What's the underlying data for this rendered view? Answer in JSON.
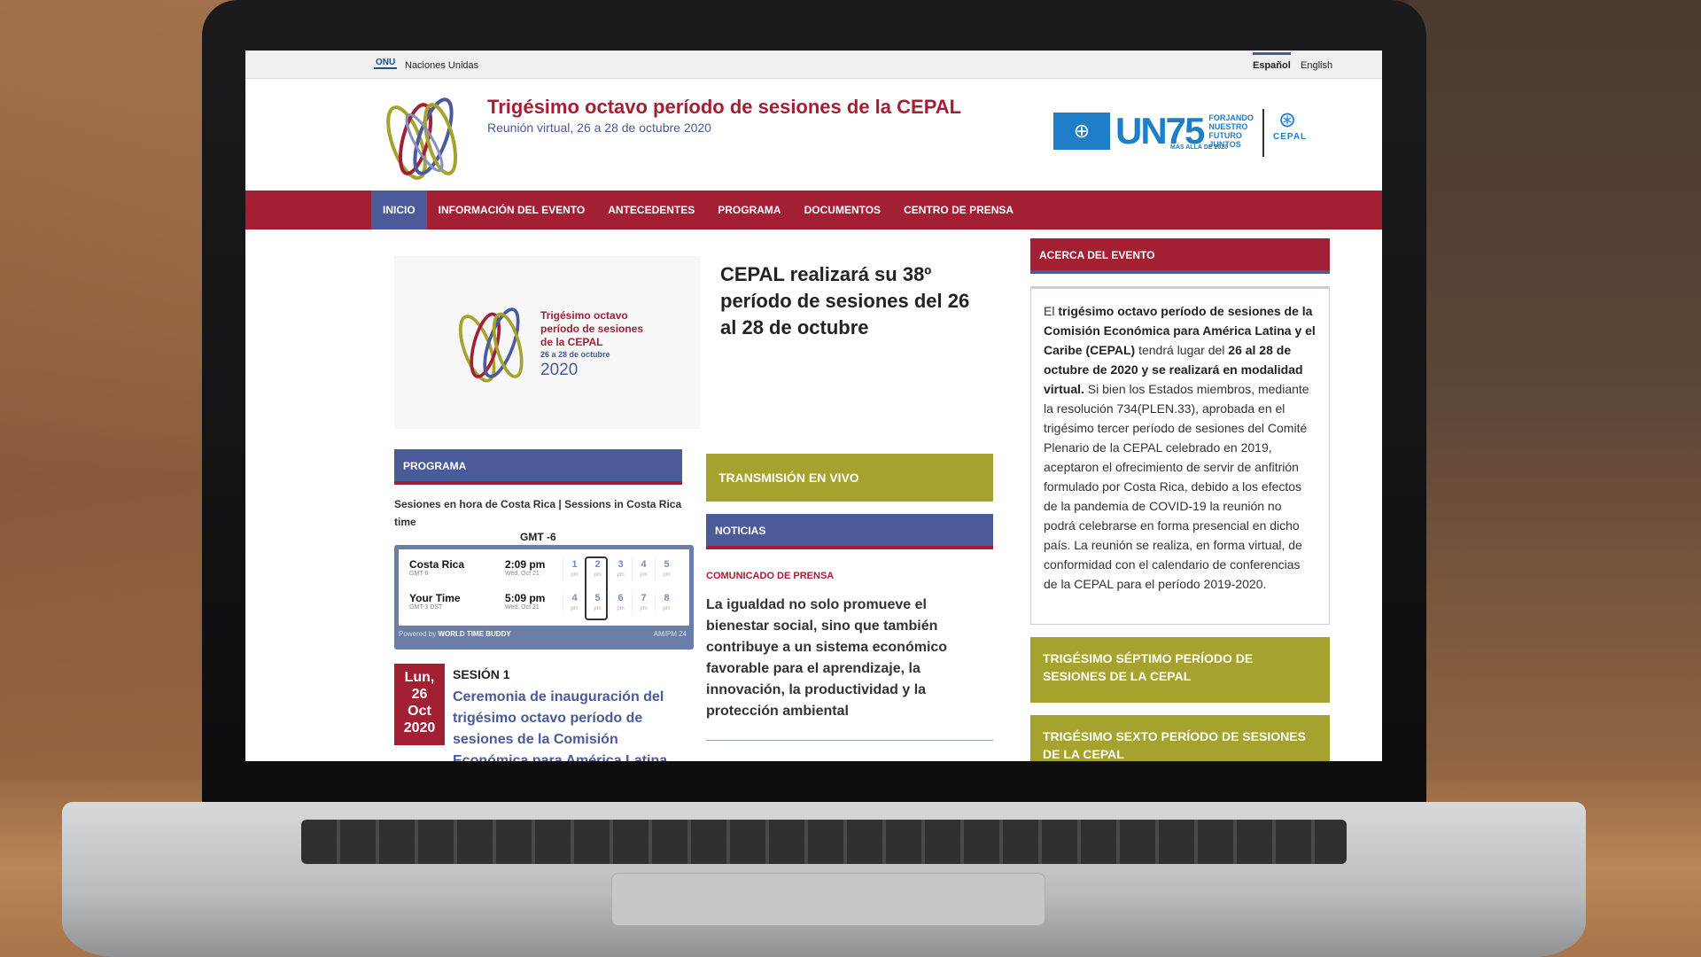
{
  "topbar": {
    "onu_badge": "ONU",
    "un_label": "Naciones Unidas",
    "lang_es": "Español",
    "lang_en": "English"
  },
  "header": {
    "title": "Trigésimo octavo período de sesiones de la CEPAL",
    "subtitle": "Reunión virtual, 26 a 28 de octubre 2020",
    "un75_main": "UN75",
    "un75_sub": [
      "FORJANDO",
      "NUESTRO",
      "FUTURO",
      "JUNTOS"
    ],
    "un75_small": "MÁS ALLÁ DE 2020",
    "cepal_logo": "CEPAL"
  },
  "nav": {
    "items": [
      "INICIO",
      "INFORMACIÓN DEL EVENTO",
      "ANTECEDENTES",
      "PROGRAMA",
      "DOCUMENTOS",
      "CENTRO DE PRENSA"
    ],
    "active_index": 0
  },
  "feature": {
    "image_title_lines": [
      "Trigésimo octavo",
      "período de sesiones",
      "de la CEPAL"
    ],
    "image_dates": "26 a 28 de octubre",
    "image_year": "2020",
    "headline": "CEPAL realizará su 38º período de sesiones del 26 al 28 de octubre"
  },
  "programa": {
    "header": "PROGRAMA",
    "sessions_text": "Sesiones en hora de Costa Rica | Sessions in Costa Rica time",
    "gmt": "GMT -6",
    "widget": {
      "row1": {
        "place": "Costa Rica",
        "tz": "GMT-6",
        "time": "2:09 pm",
        "date": "Wed, Oct 21"
      },
      "row2": {
        "place": "Your Time",
        "tz": "GMT-3 DST",
        "time": "5:09 pm",
        "date": "Wed, Oct 21"
      },
      "row1_hours": [
        "1",
        "2",
        "3",
        "4",
        "5"
      ],
      "row2_hours": [
        "4",
        "5",
        "6",
        "7",
        "8"
      ],
      "hour_unit": "pm",
      "footer_prefix": "Powered by",
      "footer_brand": "WORLD TIME BUDDY",
      "footer_right": "AM/PM  24"
    },
    "date_box": [
      "Lun,",
      "26",
      "Oct",
      "2020"
    ],
    "session_label": "SESIÓN 1",
    "session_title": "Ceremonia de inauguración del trigésimo octavo período de sesiones de la Comisión Económica para América Latina"
  },
  "middle": {
    "live_button": "TRANSMISIÓN EN VIVO",
    "news_header": "NOTICIAS",
    "press_label": "COMUNICADO DE PRENSA",
    "news_text": "La igualdad no solo promueve el bienestar social, sino que también contribuye a un sistema económico favorable para el aprendizaje, la innovación, la productividad y la protección ambiental"
  },
  "sidebar": {
    "about_header": "ACERCA DEL EVENTO",
    "about": {
      "p1": "El ",
      "b1": "trigésimo octavo período de sesiones de la Comisión Económica para América Latina y el Caribe (CEPAL)",
      "p2": " tendrá lugar del ",
      "b2": "26 al 28 de octubre de 2020 y se realizará en modalidad virtual.",
      "p3": " Si bien los Estados miembros, mediante la resolución 734(PLEN.33), aprobada en el trigésimo tercer período de sesiones del Comité Plenario de la CEPAL celebrado en 2019, aceptaron el ofrecimiento de servir de anfitrión formulado por Costa Rica, debido a los efectos de la pandemia de COVID-19 la reunión no podrá celebrarse en forma presencial en dicho país. La reunión se realiza, en forma virtual, de conformidad con el calendario de conferencias de la CEPAL para el período 2019-2020."
    },
    "button1": "TRIGÉSIMO SÉPTIMO PERÍODO DE SESIONES DE LA CEPAL",
    "button2": "TRIGÉSIMO SEXTO PERÍODO DE SESIONES DE LA CEPAL"
  },
  "colors": {
    "brand_red": "#a31f34",
    "brand_blue": "#4a5a9a",
    "olive": "#a5a22e",
    "un_blue": "#1e7ec8"
  }
}
